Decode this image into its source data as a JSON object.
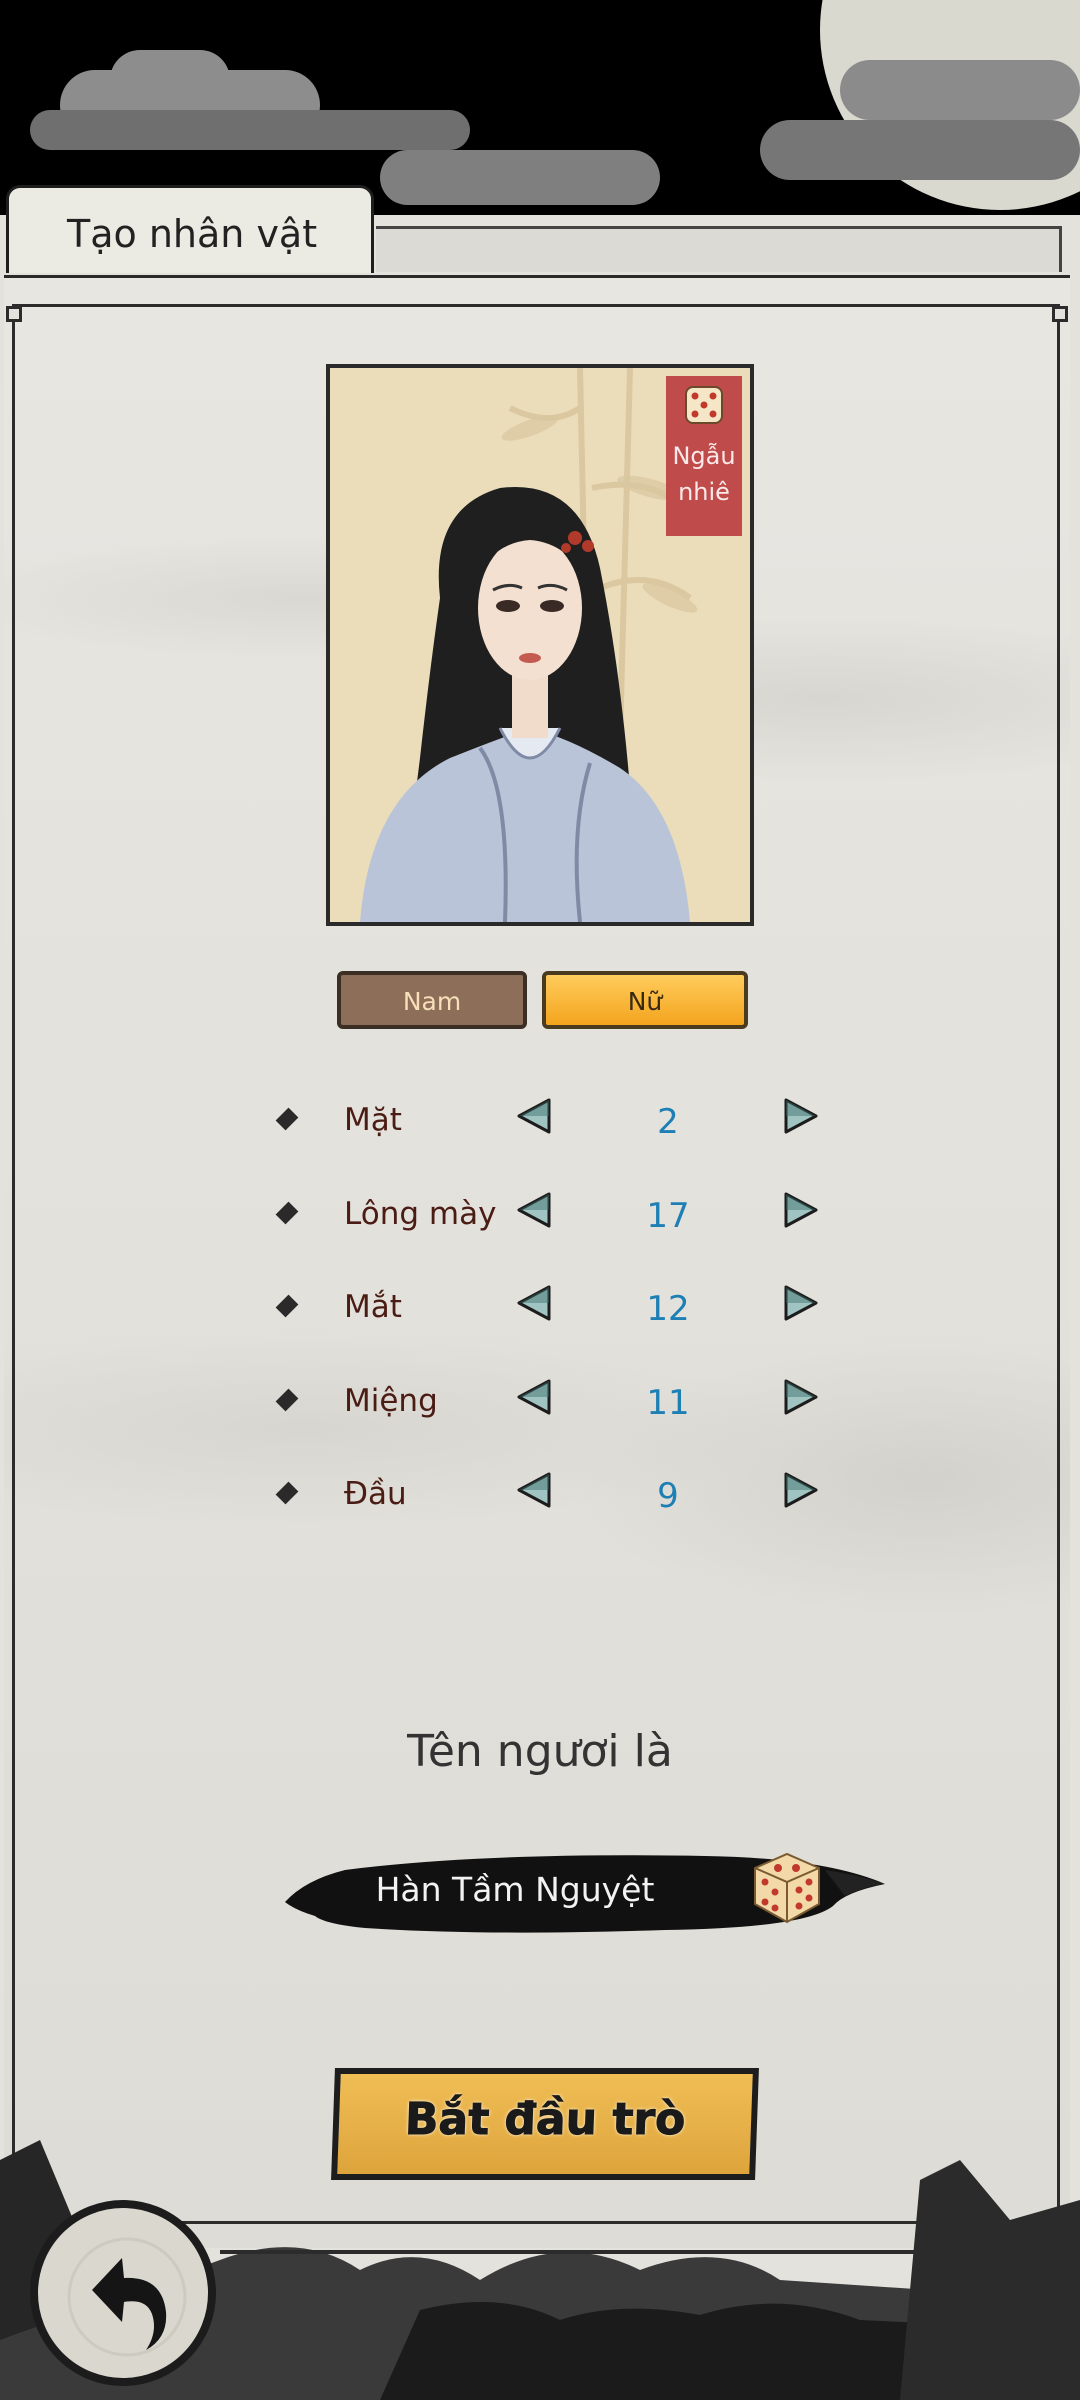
{
  "screen": {
    "tab_title": "Tạo nhân vật"
  },
  "portrait": {
    "random_label": "Ngẫu\nnhiê",
    "random_icon": "dice-icon"
  },
  "gender": {
    "male_label": "Nam",
    "female_label": "Nữ",
    "selected": "Nữ"
  },
  "attributes": [
    {
      "label": "Mặt",
      "value": "2"
    },
    {
      "label": "Lông mày",
      "value": "17"
    },
    {
      "label": "Mắt",
      "value": "12"
    },
    {
      "label": "Miệng",
      "value": "11"
    },
    {
      "label": "Đầu",
      "value": "9"
    }
  ],
  "name_section": {
    "prompt": "Tên ngươi là",
    "name_value": "Hàn Tầm Nguyệt",
    "random_icon": "dice-icon"
  },
  "start_button": {
    "label": "Bắt đầu trò"
  },
  "back_button": {
    "icon": "back-arrow-icon"
  },
  "colors": {
    "accent_gold": "#f2b54a",
    "random_badge": "#bf4b4b",
    "value_blue": "#1e7fb5",
    "label_brown": "#4a1c14"
  }
}
